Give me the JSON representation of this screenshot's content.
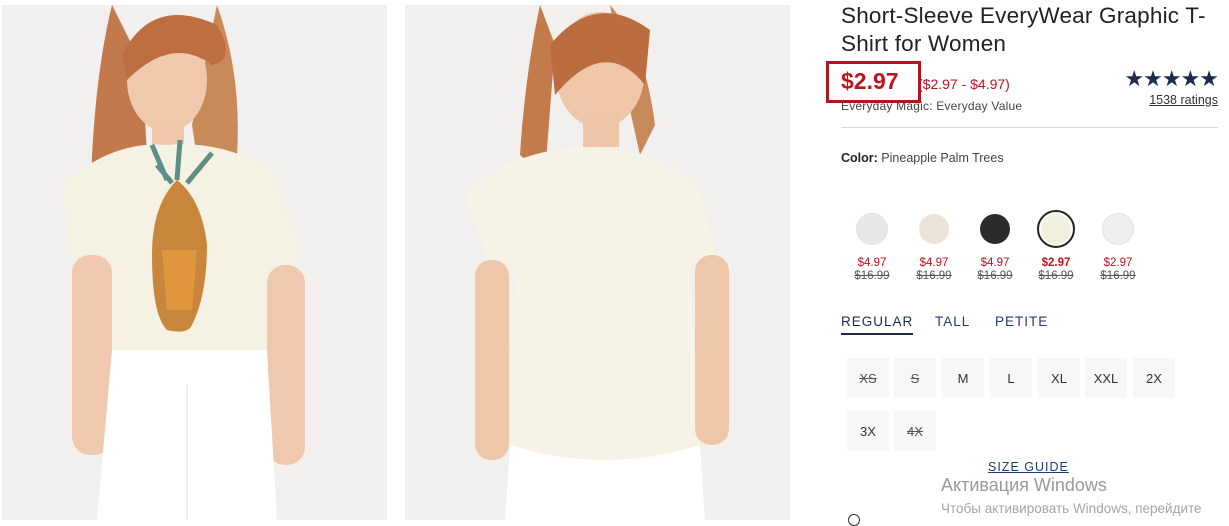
{
  "product": {
    "title": "Short-Sleeve EveryWear Graphic T-Shirt for Women",
    "price": "$2.97",
    "price_range": "($2.97 - $4.97)",
    "tagline": "Everyday Magic: Everyday Value",
    "stars": "★★★★★",
    "rating_value": 5,
    "ratings_link": "1538 ratings"
  },
  "color": {
    "label": "Color:",
    "value": "Pineapple Palm Trees",
    "swatches": [
      {
        "fill": "#e6e8e8",
        "sale": "$4.97",
        "orig": "$16.99",
        "selected": false
      },
      {
        "fill": "#ece4d9",
        "sale": "$4.97",
        "orig": "$16.99",
        "selected": false
      },
      {
        "fill": "#2b2b2b",
        "sale": "$4.97",
        "orig": "$16.99",
        "selected": false
      },
      {
        "fill": "#f3efdf",
        "sale": "$2.97",
        "orig": "$16.99",
        "selected": true
      },
      {
        "fill": "#eeeeef",
        "sale": "$2.97",
        "orig": "$16.99",
        "selected": false
      }
    ]
  },
  "size_tabs": [
    "REGULAR",
    "TALL",
    "PETITE"
  ],
  "sizes": [
    {
      "label": "XS",
      "available": false
    },
    {
      "label": "S",
      "available": false
    },
    {
      "label": "M",
      "available": true
    },
    {
      "label": "L",
      "available": true
    },
    {
      "label": "XL",
      "available": true
    },
    {
      "label": "XXL",
      "available": true
    },
    {
      "label": "2X",
      "available": true
    },
    {
      "label": "3X",
      "available": true
    },
    {
      "label": "4X",
      "available": false
    }
  ],
  "size_guide": "SIZE GUIDE",
  "watermark": {
    "title": "Активация Windows",
    "subtitle": "Чтобы активировать Windows, перейдите"
  },
  "colors": {
    "sale_red": "#c1121f",
    "navy": "#1d2c4c",
    "highlight_box": "#b3151e"
  }
}
